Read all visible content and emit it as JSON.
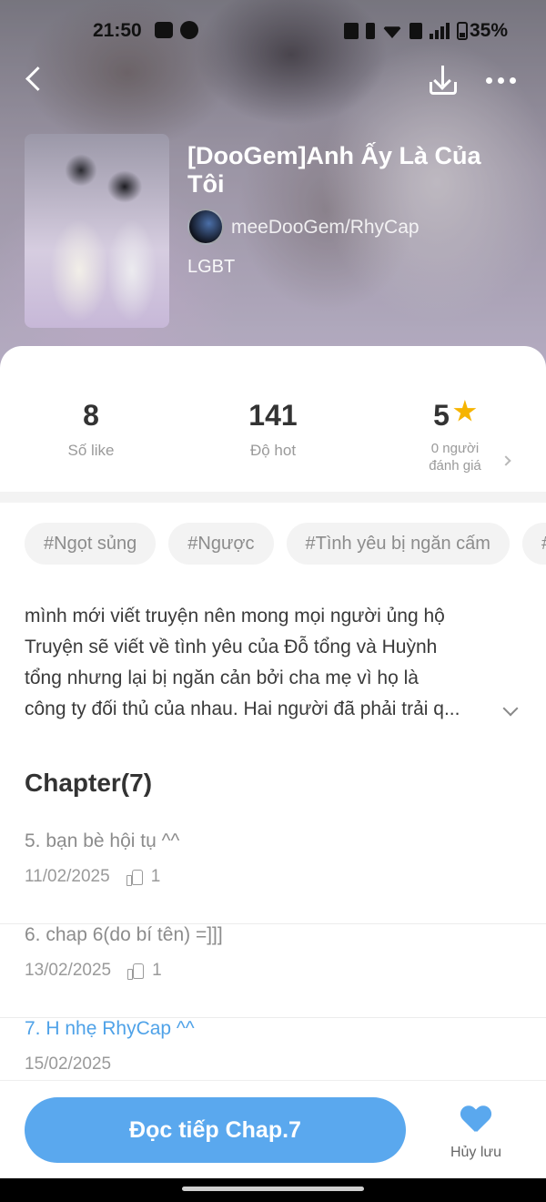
{
  "status_bar": {
    "time": "21:50",
    "battery": "35%",
    "icons": [
      "zalo-icon",
      "pinterest-icon",
      "vibrate-icon",
      "bluetooth-icon",
      "wifi-icon",
      "volte-icon",
      "signal-icon",
      "battery-icon"
    ]
  },
  "nav": {
    "back_icon": "back-chevron-icon",
    "download_icon": "download-icon",
    "more_icon": "more-dots-icon"
  },
  "story": {
    "title": "[DooGem]Anh Ấy Là Của Tôi",
    "author": "meeDooGem/RhyCap",
    "genre": "LGBT"
  },
  "stats": {
    "likes": {
      "value": "8",
      "label": "Số like"
    },
    "hot": {
      "value": "141",
      "label": "Độ hot"
    },
    "rating": {
      "value": "5",
      "label_line1": "0 người",
      "label_line2": "đánh giá"
    }
  },
  "tags": [
    "#Ngọt sủng",
    "#Ngược",
    "#Tình yêu bị ngăn cấm",
    "#"
  ],
  "description": {
    "lines": [
      "mình mới viết truyện nên mong mọi người ủng hộ",
      "Truyện sẽ viết về tình yêu của Đỗ tổng và Huỳnh",
      "tổng nhưng lại bị ngăn cản bởi cha mẹ vì họ là",
      "công ty đối thủ của nhau. Hai người đã phải trải q..."
    ]
  },
  "chapters": {
    "heading": "Chapter(7)",
    "items": [
      {
        "name": "5. bạn bè hội tụ ^^",
        "date": "11/02/2025",
        "likes": "1",
        "active": false
      },
      {
        "name": "6. chap 6(do bí tên) =]]]",
        "date": "13/02/2025",
        "likes": "1",
        "active": false
      },
      {
        "name": "7. H nhẹ RhyCap ^^",
        "date": "15/02/2025",
        "likes": "",
        "active": true
      }
    ]
  },
  "actions": {
    "read_label": "Đọc tiếp Chap.7",
    "unsave_label": "Hủy lưu"
  },
  "colors": {
    "accent": "#5aa8ee",
    "star": "#f6b400",
    "active_chapter": "#4fa2e8"
  }
}
